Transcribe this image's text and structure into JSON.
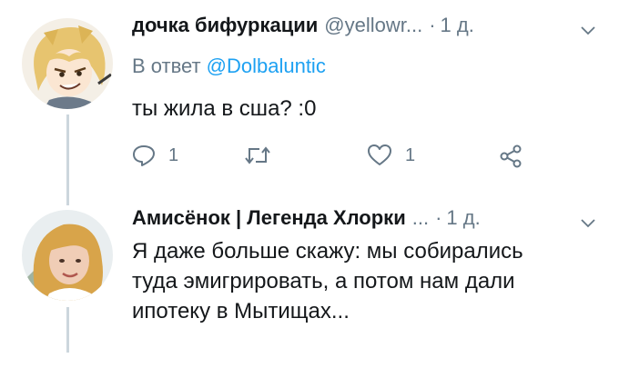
{
  "tweets": [
    {
      "display_name": "дочка бифуркации",
      "handle": "@yellowr...",
      "separator": "·",
      "time": "1 д.",
      "reply_to": {
        "prefix": "В ответ",
        "mention": "@Dolbaluntic"
      },
      "text": "ты жила в сша? :0",
      "actions": {
        "reply_count": "1",
        "retweet_count": "",
        "like_count": "1"
      },
      "avatar_icon": "anime-character-avatar"
    },
    {
      "display_name": "Амисёнок | Легенда Хлорки",
      "handle": "...",
      "separator": "·",
      "time": "1 д.",
      "text_lines": [
        "Я даже больше скажу: мы собирались",
        "туда эмигрировать, а потом нам дали",
        "ипотеку в Мытищах..."
      ],
      "avatar_icon": "user-photo-avatar"
    }
  ],
  "colors": {
    "text_primary": "#14171a",
    "text_secondary": "#657786",
    "link": "#1da1f2",
    "thread_line": "#ccd6dd"
  }
}
